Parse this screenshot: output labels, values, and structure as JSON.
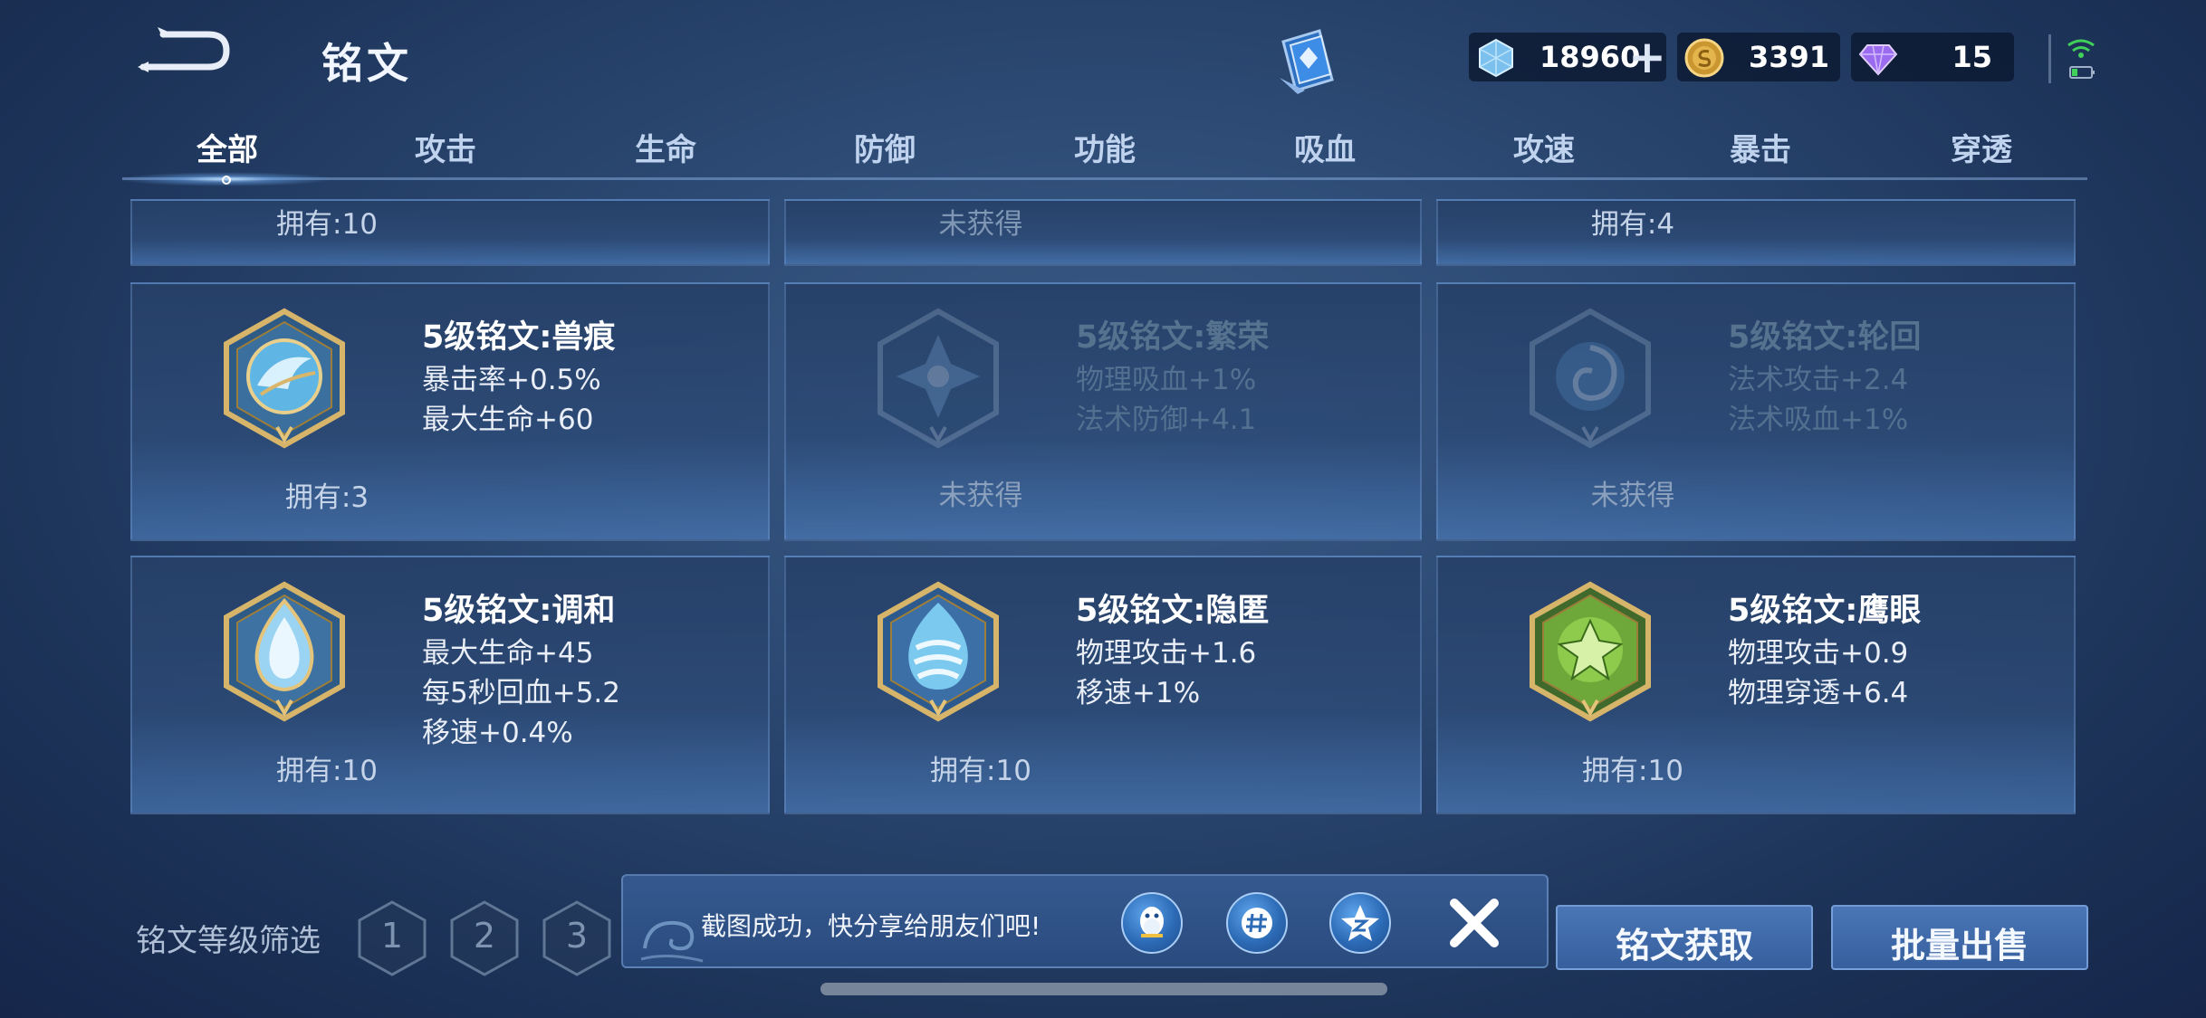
{
  "header": {
    "title": "铭文",
    "currencies": {
      "coupon": {
        "value": "18960",
        "add_label": "+"
      },
      "gold": {
        "value": "3391"
      },
      "gem": {
        "value": "15"
      }
    }
  },
  "tabs": [
    {
      "label": "全部",
      "active": true
    },
    {
      "label": "攻击"
    },
    {
      "label": "生命"
    },
    {
      "label": "防御"
    },
    {
      "label": "功能"
    },
    {
      "label": "吸血"
    },
    {
      "label": "攻速"
    },
    {
      "label": "暴击"
    },
    {
      "label": "穿透"
    }
  ],
  "top_partial_cards": [
    {
      "owned": "拥有:10"
    },
    {
      "owned": "未获得"
    },
    {
      "owned": "拥有:4"
    }
  ],
  "cards": [
    {
      "title": "5级铭文:兽痕",
      "stats": [
        "暴击率+0.5%",
        "最大生命+60"
      ],
      "owned": "拥有:3",
      "locked": false,
      "icon": "beast-mark-icon"
    },
    {
      "title": "5级铭文:繁荣",
      "stats": [
        "物理吸血+1%",
        "法术防御+4.1"
      ],
      "owned": "未获得",
      "locked": true,
      "icon": "prosperity-icon"
    },
    {
      "title": "5级铭文:轮回",
      "stats": [
        "法术攻击+2.4",
        "法术吸血+1%"
      ],
      "owned": "未获得",
      "locked": true,
      "icon": "reincarnation-icon"
    },
    {
      "title": "5级铭文:调和",
      "stats": [
        "最大生命+45",
        "每5秒回血+5.2",
        "移速+0.4%"
      ],
      "owned": "拥有:10",
      "locked": false,
      "icon": "harmony-icon"
    },
    {
      "title": "5级铭文:隐匿",
      "stats": [
        "物理攻击+1.6",
        "移速+1%"
      ],
      "owned": "拥有:10",
      "locked": false,
      "icon": "stealth-icon"
    },
    {
      "title": "5级铭文:鹰眼",
      "stats": [
        "物理攻击+0.9",
        "物理穿透+6.4"
      ],
      "owned": "拥有:10",
      "locked": false,
      "icon": "eagle-eye-icon"
    }
  ],
  "filter": {
    "label": "铭文等级筛选",
    "levels": [
      "1",
      "2",
      "3"
    ]
  },
  "share": {
    "text": "截图成功，快分享给朋友们吧!"
  },
  "buttons": {
    "obtain": "铭文获取",
    "bulk_sell": "批量出售"
  }
}
